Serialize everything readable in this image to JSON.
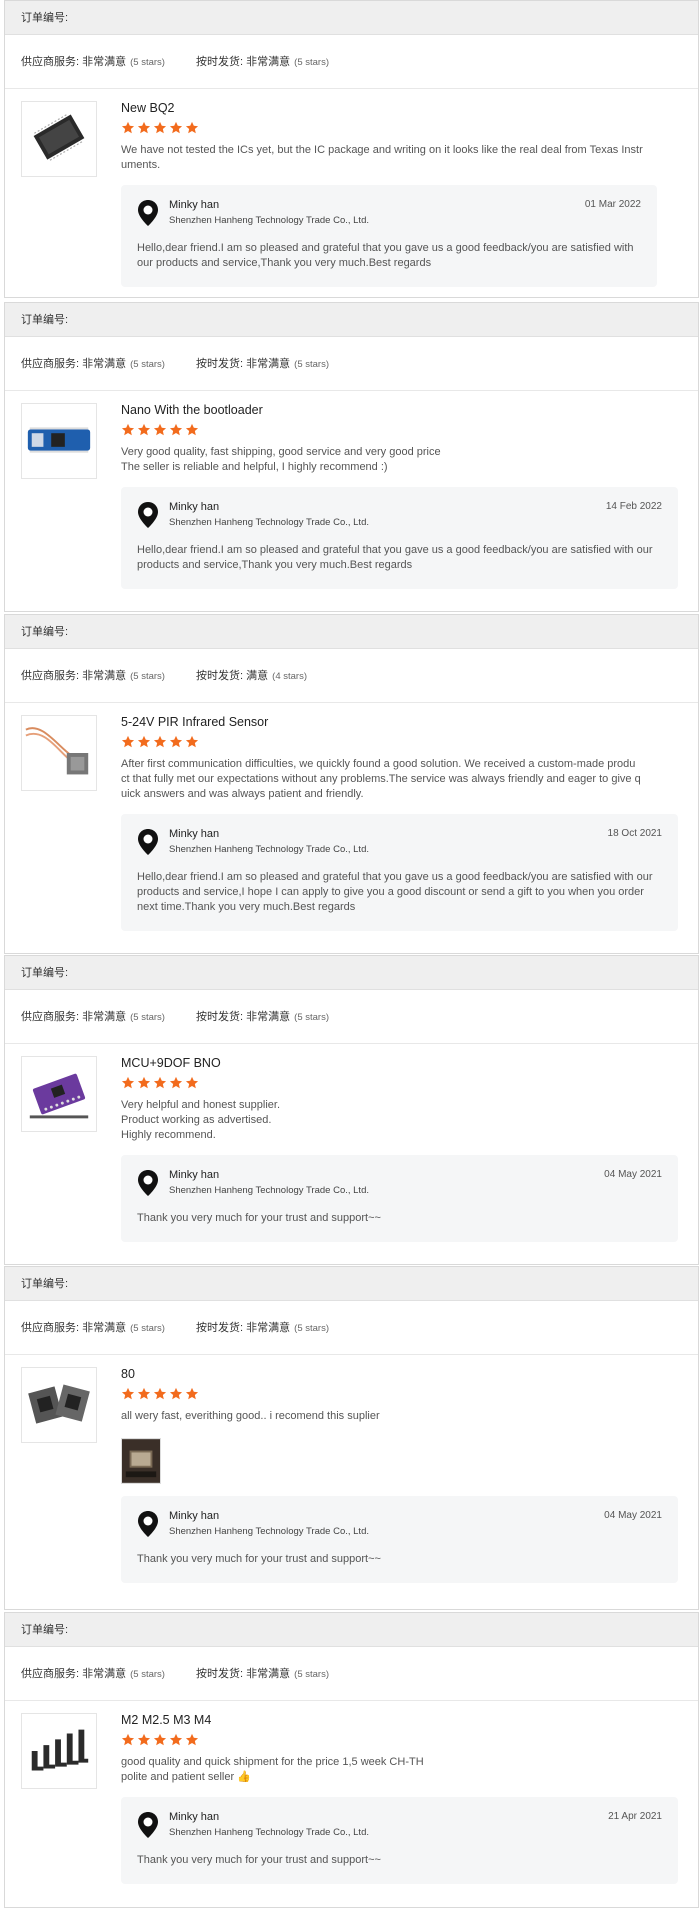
{
  "labels": {
    "order_no": "订单编号:",
    "supplier_service": "供应商服务:",
    "on_time": "按时发货:"
  },
  "seller_reply": {
    "name": "Minky han",
    "company": "Shenzhen Hanheng Technology Trade Co., Ltd."
  },
  "reviews": [
    {
      "supplier_rating": "非常满意",
      "supplier_stars": "(5 stars)",
      "delivery_rating": "非常满意",
      "delivery_stars": "(5 stars)",
      "title": "New BQ2",
      "stars": 5,
      "text": "We have not tested the ICs yet, but the IC package and writing on it looks like the real deal from Texas Instr\numents.",
      "reply_date": "01 Mar 2022",
      "reply_text": "Hello,dear friend.I am so pleased and grateful that you gave us a good feedback/you are satisfied with our products and service,Thank you very much.Best regards"
    },
    {
      "supplier_rating": "非常满意",
      "supplier_stars": "(5 stars)",
      "delivery_rating": "非常满意",
      "delivery_stars": "(5 stars)",
      "title": "Nano With the bootloader",
      "stars": 5,
      "text": "Very good quality, fast shipping, good service and very good price\nThe seller is reliable and helpful, I highly recommend :)",
      "reply_date": "14 Feb 2022",
      "reply_text": "Hello,dear friend.I am so pleased and grateful that you gave us a good feedback/you are satisfied with our products and service,Thank you very much.Best regards"
    },
    {
      "supplier_rating": "非常满意",
      "supplier_stars": "(5 stars)",
      "delivery_rating": "满意",
      "delivery_stars": "(4 stars)",
      "title": "5-24V PIR Infrared Sensor",
      "stars": 5,
      "text": "After first communication difficulties, we quickly found a good solution. We received a custom-made produ\nct that fully met our expectations without any problems.The service was always friendly and eager to give q\nuick answers and was always patient and friendly.",
      "reply_date": "18 Oct 2021",
      "reply_text": "Hello,dear friend.I am so pleased and grateful that you gave us a good feedback/you are satisfied with our products and service,I hope I can apply to give you a good discount or send a gift to you when you order next time.Thank you very much.Best regards"
    },
    {
      "supplier_rating": "非常满意",
      "supplier_stars": "(5 stars)",
      "delivery_rating": "非常满意",
      "delivery_stars": "(5 stars)",
      "title": "MCU+9DOF BNO",
      "stars": 5,
      "text": "Very helpful and honest supplier.\nProduct working as advertised.\nHighly recommend.",
      "reply_date": "04 May 2021",
      "reply_text": "Thank you very much for your trust and support~~"
    },
    {
      "supplier_rating": "非常满意",
      "supplier_stars": "(5 stars)",
      "delivery_rating": "非常满意",
      "delivery_stars": "(5 stars)",
      "title": "80",
      "stars": 5,
      "text": "all wery fast, everithing good.. i recomend this suplier",
      "reply_date": "04 May 2021",
      "reply_text": "Thank you very much for your trust and support~~"
    },
    {
      "supplier_rating": "非常满意",
      "supplier_stars": "(5 stars)",
      "delivery_rating": "非常满意",
      "delivery_stars": "(5 stars)",
      "title": "M2 M2.5 M3 M4",
      "stars": 5,
      "text": "good quality and quick shipment for the price 1,5 week CH-TH\npolite and patient seller 👍",
      "reply_date": "21 Apr 2021",
      "reply_text": "Thank you very much for your trust and support~~"
    }
  ],
  "colors": {
    "star": "#f26b1d",
    "header_bg": "#efefef",
    "reply_bg": "#f5f6f7"
  }
}
